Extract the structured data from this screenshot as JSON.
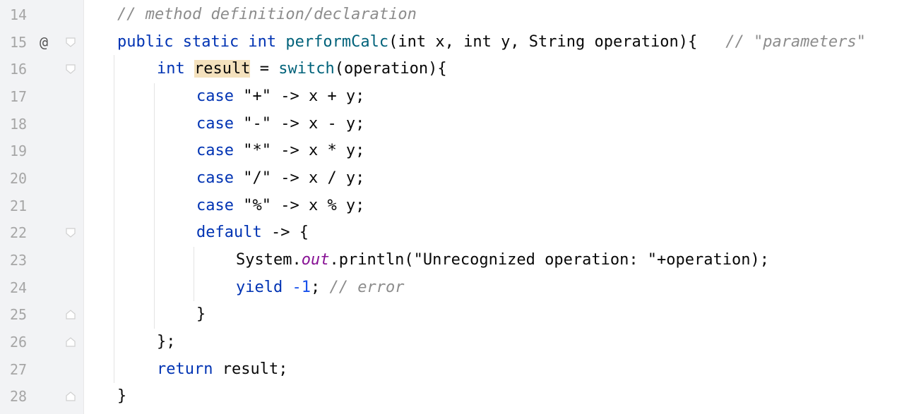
{
  "editor": {
    "lines": [
      {
        "number": "14",
        "text": "// method definition/declaration"
      },
      {
        "number": "15",
        "marker": "@",
        "p1": "public static int ",
        "fn": "performCalc",
        "p2": "(int x, int y, String operation){",
        "comment": "// \"parameters\""
      },
      {
        "number": "16",
        "kw": "int ",
        "var": "result",
        "eq": " = ",
        "sw": "switch",
        "rest": "(operation){"
      },
      {
        "number": "17",
        "kw": "case ",
        "rest": "\"+\" -> x + y;"
      },
      {
        "number": "18",
        "kw": "case ",
        "rest": "\"-\" -> x - y;"
      },
      {
        "number": "19",
        "kw": "case ",
        "rest": "\"*\" -> x * y;"
      },
      {
        "number": "20",
        "kw": "case ",
        "rest": "\"/\" -> x / y;"
      },
      {
        "number": "21",
        "kw": "case ",
        "rest": "\"%\" -> x % y;"
      },
      {
        "number": "22",
        "kw": "default",
        "rest": " -> {"
      },
      {
        "number": "23",
        "cls": "System.",
        "fld": "out",
        "rest": ".println(\"Unrecognized operation: \"+operation);"
      },
      {
        "number": "24",
        "kw": "yield ",
        "num": "-1",
        "rest": "; ",
        "comment": "// error"
      },
      {
        "number": "25",
        "text": "}"
      },
      {
        "number": "26",
        "text": "};"
      },
      {
        "number": "27",
        "kw": "return ",
        "rest": "result;"
      },
      {
        "number": "28",
        "text": "}"
      }
    ]
  },
  "colors": {
    "keyword": "#0033b3",
    "function": "#00627a",
    "comment": "#8c8c8c",
    "highlight": "#f4e1bd",
    "gutter": "#f2f3f5"
  },
  "icons": {
    "fold_open": "fold-open-icon",
    "fold_close": "fold-close-icon",
    "override": "at-sign-icon"
  }
}
